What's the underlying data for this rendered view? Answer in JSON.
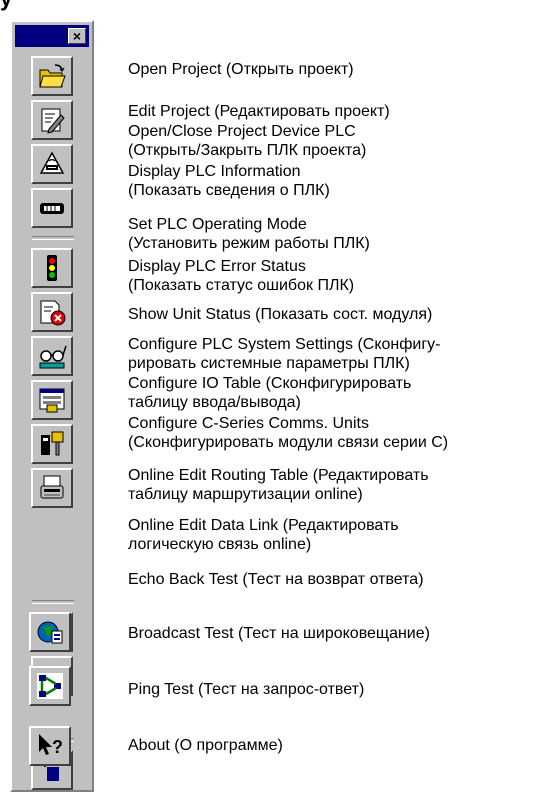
{
  "title_fragment": "y",
  "toolbar": {
    "close_label": "×",
    "items": [
      {
        "icon": "open-folder-icon",
        "line1": "Open Project (Открыть проект)",
        "line2": ""
      },
      {
        "icon": "edit-document-icon",
        "line1": "Edit Project (Редактировать проект)",
        "line2": ""
      },
      {
        "icon": "plc-connect-icon",
        "line1": "Open/Close Project Device PLC",
        "line2": "(Открыть/Закрыть ПЛК проекта)"
      },
      {
        "icon": "plc-info-icon",
        "line1": "Display PLC Information",
        "line2": "(Показать сведения о ПЛК)"
      },
      {
        "icon": "traffic-light-icon",
        "line1": "Set PLC Operating Mode",
        "line2": "(Установить режим работы ПЛК)"
      },
      {
        "icon": "error-status-icon",
        "line1": "Display PLC Error Status",
        "line2": "(Показать статус ошибок ПЛК)"
      },
      {
        "icon": "glasses-icon",
        "line1": "Show Unit Status (Показать сост. модуля)",
        "line2": ""
      },
      {
        "icon": "system-settings-icon",
        "line1": "Configure PLC System Settings (Сконфигу-",
        "line2": "рировать системные параметры ПЛК)"
      },
      {
        "icon": "io-table-icon",
        "line1": "Configure IO Table (Сконфигурировать",
        "line2": "таблицу ввода/вывода)"
      },
      {
        "icon": "comms-unit-icon",
        "line1": "Configure C-Series Comms. Units",
        "line2": "(Сконфигурировать модули связи серии C)"
      },
      {
        "icon": "routing-table-icon",
        "line1": "Online Edit Routing Table (Редактировать",
        "line2": "таблицу маршрутизации online)"
      },
      {
        "icon": "data-link-icon",
        "line1": "Online Edit Data Link (Редактировать",
        "line2": "логическую связь online)"
      },
      {
        "icon": "echo-back-icon",
        "line1": "Echo Back Test (Тест на возврат ответа)",
        "line2": ""
      },
      {
        "icon": "broadcast-globe-icon",
        "line1": "Broadcast Test (Тест на широковещание)",
        "line2": ""
      },
      {
        "icon": "ping-network-icon",
        "line1": "Ping Test (Тест на запрос-ответ)",
        "line2": ""
      },
      {
        "icon": "help-pointer-icon",
        "line1": "About (О программе)",
        "line2": ""
      }
    ]
  }
}
